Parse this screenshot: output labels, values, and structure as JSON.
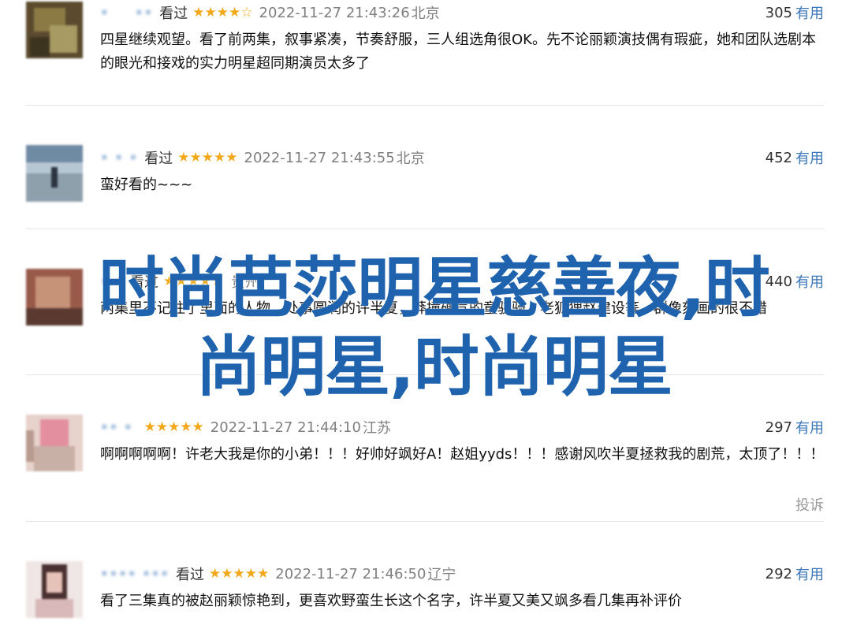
{
  "reviews": [
    {
      "user": "•   ••",
      "seen": "看过",
      "stars": "★★★★☆",
      "time": "2022-11-27 21:43:26",
      "location": "北京",
      "useful_count": "305",
      "useful_label": "有用",
      "content": "四星继续观望。看了前两集，叙事紧凑，节奏舒服，三人组选角很OK。先不论丽颖演技偶有瑕疵，她和团队选剧本的眼光和接戏的实力明星超同期演员太多了"
    },
    {
      "user": "• • •",
      "seen": "看过",
      "stars": "★★★★★",
      "time": "2022-11-27 21:43:55",
      "location": "北京",
      "useful_count": "452",
      "useful_label": "有用",
      "content": "蛮好看的~~~"
    },
    {
      "user": "• •",
      "seen": "看过",
      "stars": "★★★★★",
      "time": "",
      "location": "贵州",
      "useful_count": "440",
      "useful_label": "有用",
      "content": "两集里不记住了里面的人物，处事圆润的许半夏，莽撞硬气的童骁骑，老狐狸赵建设等，群像刻画的很不错"
    },
    {
      "user": "•• •",
      "seen": "",
      "stars": "★★★★★",
      "time": "2022-11-27 21:44:10",
      "location": "江苏",
      "useful_count": "297",
      "useful_label": "有用",
      "content": "啊啊啊啊啊！许老大我是你的小弟！！！好帅好飒好A！赵姐yyds！！！感谢风吹半夏拯救我的剧荒，太顶了！！！",
      "report_label": "投诉"
    },
    {
      "user": "•••• •••",
      "seen": "看过",
      "stars": "★★★★★",
      "time": "2022-11-27 21:46:50",
      "location": "辽宁",
      "useful_count": "292",
      "useful_label": "有用",
      "content": "看了三集真的被赵丽颖惊艳到，更喜欢野蛮生长这个名字，许半夏又美又飒多看几集再补评价"
    }
  ],
  "overlay": {
    "line1": "时尚芭莎明星慈善夜,时",
    "line2": "尚明星,时尚明星"
  },
  "colors": {
    "link": "#3a76b8",
    "star": "#f2a81a",
    "meta": "#7f7f7f",
    "overlay": "#1f62ad"
  }
}
